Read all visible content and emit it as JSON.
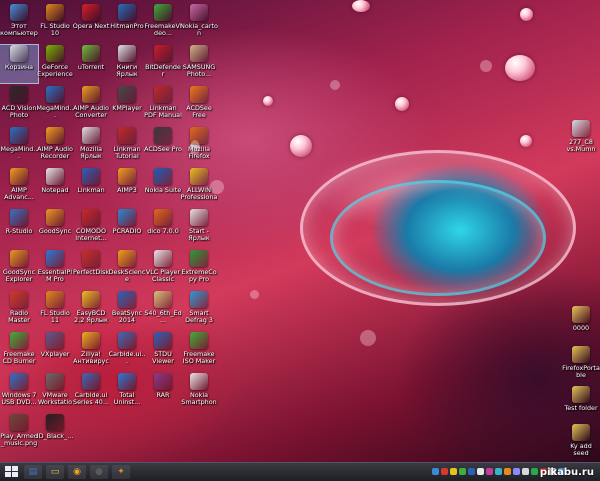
{
  "desktop": {
    "left_icons": [
      {
        "label": "Этот компьютер",
        "icon": "computer-icon",
        "color": "#4a8fd6"
      },
      {
        "label": "FL Studio 10",
        "icon": "fl-studio-icon",
        "color": "#e08a1e"
      },
      {
        "label": "Opera Next",
        "icon": "opera-icon",
        "color": "#d8202c"
      },
      {
        "label": "HitmanPro",
        "icon": "hitman-icon",
        "color": "#2a6fb8"
      },
      {
        "label": "FreemakeVideo...",
        "icon": "freemake-icon",
        "color": "#3fae3a"
      },
      {
        "label": "Nokia_carton",
        "icon": "folder-icon",
        "color": "#c86aa8"
      },
      {
        "label": "Корзина",
        "icon": "recycle-bin-icon",
        "color": "#d9dde3"
      },
      {
        "label": "GeForce Experience",
        "icon": "geforce-icon",
        "color": "#76b900"
      },
      {
        "label": "uTorrent",
        "icon": "utorrent-icon",
        "color": "#6fbf3c"
      },
      {
        "label": "Книги Ярлык",
        "icon": "shortcut-icon",
        "color": "#e2e2e2"
      },
      {
        "label": "BitDefender",
        "icon": "bitdefender-icon",
        "color": "#c8202a"
      },
      {
        "label": "SAMSUNG Photo...",
        "icon": "photo-icon",
        "color": "#d2b58a"
      },
      {
        "label": "ACD Vision Photo Viewer",
        "icon": "viewer-icon",
        "color": "#2b2b2b"
      },
      {
        "label": "MegaMind...",
        "icon": "app-icon",
        "color": "#2b72c4"
      },
      {
        "label": "AIMP Audio Converter",
        "icon": "aimp-icon",
        "color": "#f2a020"
      },
      {
        "label": "KMPlayer",
        "icon": "kmplayer-icon",
        "color": "#4a4a4a"
      },
      {
        "label": "Linkman PDF Manual",
        "icon": "pdf-icon",
        "color": "#c02a2a"
      },
      {
        "label": "ACDSee Free",
        "icon": "acdsee-icon",
        "color": "#f07a1a"
      },
      {
        "label": "MegaMind...",
        "icon": "app-icon",
        "color": "#2b72c4"
      },
      {
        "label": "AIMP Audio Recorder",
        "icon": "aimp-icon",
        "color": "#f2a020"
      },
      {
        "label": "Mozilla Ярлык",
        "icon": "shortcut-icon",
        "color": "#e2e2e2"
      },
      {
        "label": "Linkman Tutorial",
        "icon": "pdf-icon",
        "color": "#c02a2a"
      },
      {
        "label": "ACDSee Pro",
        "icon": "acdsee-icon",
        "color": "#3a3a3a"
      },
      {
        "label": "Mozilla Firefox",
        "icon": "firefox-icon",
        "color": "#e26a1c"
      },
      {
        "label": "AIMP Advanc...",
        "icon": "aimp-icon",
        "color": "#f2a020"
      },
      {
        "label": "Notepad",
        "icon": "notepad-icon",
        "color": "#e8e8e8"
      },
      {
        "label": "Linkman",
        "icon": "linkman-icon",
        "color": "#2a62b8"
      },
      {
        "label": "AIMP3",
        "icon": "aimp-icon",
        "color": "#f2a020"
      },
      {
        "label": "Nokia Suite",
        "icon": "nokia-icon",
        "color": "#1c5fb6"
      },
      {
        "label": "ALLWIN Professional",
        "icon": "app-icon",
        "color": "#e8c020"
      },
      {
        "label": "R-Studio",
        "icon": "r-studio-icon",
        "color": "#3474c4"
      },
      {
        "label": "GoodSync",
        "icon": "goodsync-icon",
        "color": "#e89a22"
      },
      {
        "label": "COMODO Internet...",
        "icon": "comodo-icon",
        "color": "#c82a2a"
      },
      {
        "label": "PCRADIO",
        "icon": "radio-icon",
        "color": "#2a8ad4"
      },
      {
        "label": "dico 7.0.0",
        "icon": "app-icon",
        "color": "#e06a1a"
      },
      {
        "label": "Start - Ярлык",
        "icon": "shortcut-icon",
        "color": "#e2e2e2"
      },
      {
        "label": "GoodSync Explorer",
        "icon": "goodsync-icon",
        "color": "#e89a22"
      },
      {
        "label": "EssentialPIM Pro",
        "icon": "pim-icon",
        "color": "#2a7ad4"
      },
      {
        "label": "PerfectDisk",
        "icon": "disk-icon",
        "color": "#c8302a"
      },
      {
        "label": "DeskScience",
        "icon": "app-icon",
        "color": "#f0a01c"
      },
      {
        "label": "VLC Player Classic",
        "icon": "player-icon",
        "color": "#e8e8e8"
      },
      {
        "label": "ExtremeCopy Pro",
        "icon": "copy-icon",
        "color": "#2a9a3a"
      },
      {
        "label": "Radio Master",
        "icon": "radio-icon",
        "color": "#d43a2a"
      },
      {
        "label": "FL Studio 11",
        "icon": "fl-studio-icon",
        "color": "#e08a1e"
      },
      {
        "label": "EasyBCD 2.2 Ярлык",
        "icon": "shortcut-icon",
        "color": "#e8c020"
      },
      {
        "label": "BeatSync 2014",
        "icon": "app-icon",
        "color": "#2a62b8"
      },
      {
        "label": "S40_6th_Ed...",
        "icon": "folder-icon",
        "color": "#d8c27a"
      },
      {
        "label": "Smart Defrag 3",
        "icon": "defrag-icon",
        "color": "#2a9ad4"
      },
      {
        "label": "Freemake CD Burner Ярлык",
        "icon": "burner-icon",
        "color": "#3fae3a"
      },
      {
        "label": "VXplayer",
        "icon": "player-icon",
        "color": "#5a5a8a"
      },
      {
        "label": "Zillya! Антивирус",
        "icon": "antivirus-icon",
        "color": "#e8b020"
      },
      {
        "label": "Carbide.ui...",
        "icon": "carbide-icon",
        "color": "#3a6ab8"
      },
      {
        "label": "STDU Viewer",
        "icon": "viewer-icon",
        "color": "#2a62b8"
      },
      {
        "label": "Freemake ISO Maker Ярлык",
        "icon": "iso-icon",
        "color": "#3fae3a"
      },
      {
        "label": "Windows 7 USB DVD...",
        "icon": "usb-icon",
        "color": "#2a72c4"
      },
      {
        "label": "VMware Workstation",
        "icon": "vmware-icon",
        "color": "#6a6a6a"
      },
      {
        "label": "Carbide.ui Series 40...",
        "icon": "carbide-icon",
        "color": "#3a6ab8"
      },
      {
        "label": "Total Uninst...",
        "icon": "uninstall-icon",
        "color": "#2a7ad4"
      },
      {
        "label": "RAR",
        "icon": "rar-icon",
        "color": "#8a3a8a"
      },
      {
        "label": "Nokia Smartphone...",
        "icon": "nokia-icon",
        "color": "#e8e8e8"
      },
      {
        "label": "Play_Armed_music.png",
        "icon": "image-file-icon",
        "color": "#6a4a3a"
      },
      {
        "label": "ID_Black_...",
        "icon": "image-file-icon",
        "color": "#202020"
      }
    ],
    "right_icons": [
      {
        "label": "277_C8 vs.Mumn",
        "icon": "image-file-icon",
        "color": "#d8dde4"
      },
      {
        "label": "0000",
        "icon": "folder-icon",
        "color": "#e8c45a"
      },
      {
        "label": "FirefoxPortable",
        "icon": "folder-icon",
        "color": "#e8c45a"
      },
      {
        "label": "Test folder",
        "icon": "folder-icon",
        "color": "#e8c45a"
      },
      {
        "label": "Ky add seed",
        "icon": "folder-icon",
        "color": "#e8c45a"
      }
    ]
  },
  "taskbar": {
    "start_label": "Start",
    "pinned": [
      {
        "icon": "explorer-icon",
        "color": "#3a7ac8",
        "glyph": "▤"
      },
      {
        "icon": "folder-icon",
        "color": "#e8c45a",
        "glyph": "▭"
      },
      {
        "icon": "aimp-icon",
        "color": "#f2a020",
        "glyph": "◉"
      },
      {
        "icon": "media-icon",
        "color": "#5a5a5a",
        "glyph": "●"
      },
      {
        "icon": "fl-studio-icon",
        "color": "#e08a1e",
        "glyph": "✦"
      }
    ],
    "tray_colors": [
      "#3a8ad4",
      "#d43a2a",
      "#e8c020",
      "#3fae3a",
      "#2a62b8",
      "#e8e8e8",
      "#c83a9a",
      "#3ab4c8",
      "#e88a1a",
      "#8a8aff",
      "#d8d8d8",
      "#2aa84a",
      "#c8302a",
      "#e8e8e8",
      "#4a9ae8"
    ],
    "clock_time": "",
    "clock_date": ""
  },
  "watermark": "pikabu.ru"
}
